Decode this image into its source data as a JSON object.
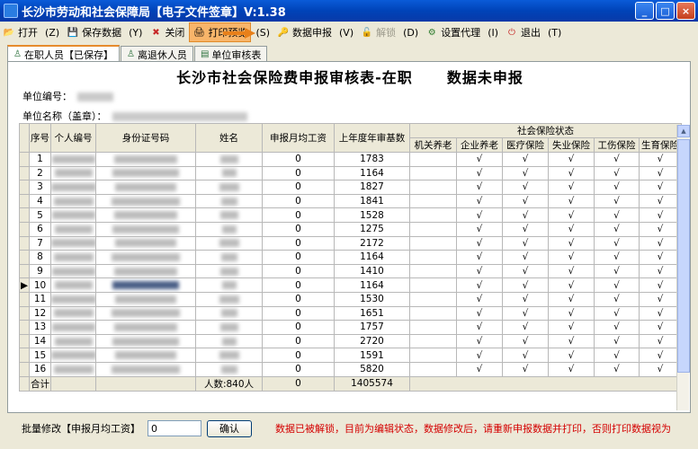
{
  "window": {
    "title": "长沙市劳动和社会保障局【电子文件签章】V:1.38",
    "controls": [
      "_",
      "□",
      "×"
    ]
  },
  "toolbar": [
    {
      "key": "open",
      "label": "打开",
      "icon": "folder-icon",
      "hotkey": "(Z)",
      "disabled": false
    },
    {
      "key": "save",
      "label": "保存数据",
      "icon": "save-icon",
      "hotkey": "(Y)",
      "disabled": false
    },
    {
      "key": "close",
      "label": "关闭",
      "icon": "close-x-icon",
      "hotkey": "",
      "disabled": false
    },
    {
      "key": "preview",
      "label": "打印预览",
      "icon": "print-preview-icon",
      "hotkey": "(S)",
      "disabled": false,
      "highlight": true
    },
    {
      "key": "declare",
      "label": "数据申报",
      "icon": "key-icon",
      "hotkey": "(V)",
      "disabled": false
    },
    {
      "key": "unlock",
      "label": "解锁",
      "icon": "unlock-icon",
      "hotkey": "(D)",
      "disabled": true
    },
    {
      "key": "proxy",
      "label": "设置代理",
      "icon": "proxy-icon",
      "hotkey": "(I)",
      "disabled": false
    },
    {
      "key": "exit",
      "label": "退出",
      "icon": "exit-icon",
      "hotkey": "(T)",
      "disabled": false
    }
  ],
  "tabs": [
    {
      "label": "在职人员【已保存】",
      "icon": "person-icon",
      "active": true
    },
    {
      "label": "离退休人员",
      "icon": "person-icon",
      "active": false
    },
    {
      "label": "单位审核表",
      "icon": "document-icon",
      "active": false
    }
  ],
  "report": {
    "title": "长沙市社会保险费申报审核表-在职",
    "status": "数据未申报",
    "unit_code_label": "单位编号：",
    "unit_name_label": "单位名称（盖章）："
  },
  "table": {
    "headers": {
      "seq": "序号",
      "person_id": "个人编号",
      "id_card": "身份证号码",
      "name": "姓名",
      "monthly_wage": "申报月均工资",
      "prev_base": "上年度年审基数",
      "group": "社会保险状态",
      "insurance": [
        "机关养老",
        "企业养老",
        "医疗保险",
        "失业保险",
        "工伤保险",
        "生育保险"
      ]
    },
    "check": "√",
    "selected_row": 10,
    "rows": [
      {
        "seq": "1",
        "wage": "0",
        "base": "1783"
      },
      {
        "seq": "2",
        "wage": "0",
        "base": "1164"
      },
      {
        "seq": "3",
        "wage": "0",
        "base": "1827"
      },
      {
        "seq": "4",
        "wage": "0",
        "base": "1841"
      },
      {
        "seq": "5",
        "wage": "0",
        "base": "1528"
      },
      {
        "seq": "6",
        "wage": "0",
        "base": "1275"
      },
      {
        "seq": "7",
        "wage": "0",
        "base": "2172"
      },
      {
        "seq": "8",
        "wage": "0",
        "base": "1164"
      },
      {
        "seq": "9",
        "wage": "0",
        "base": "1410"
      },
      {
        "seq": "10",
        "wage": "0",
        "base": "1164"
      },
      {
        "seq": "11",
        "wage": "0",
        "base": "1530"
      },
      {
        "seq": "12",
        "wage": "0",
        "base": "1651"
      },
      {
        "seq": "13",
        "wage": "0",
        "base": "1757"
      },
      {
        "seq": "14",
        "wage": "0",
        "base": "2720"
      },
      {
        "seq": "15",
        "wage": "0",
        "base": "1591"
      },
      {
        "seq": "16",
        "wage": "0",
        "base": "5820"
      }
    ],
    "footer": {
      "label": "合计",
      "count": "人数:840人",
      "wage_total": "0",
      "base_total": "1405574"
    }
  },
  "bottom": {
    "label": "批量修改【申报月均工资】",
    "input_value": "0",
    "confirm": "确认",
    "notice": "数据已被解锁，目前为编辑状态，数据修改后，请重新申报数据并打印，否则打印数据视为"
  }
}
